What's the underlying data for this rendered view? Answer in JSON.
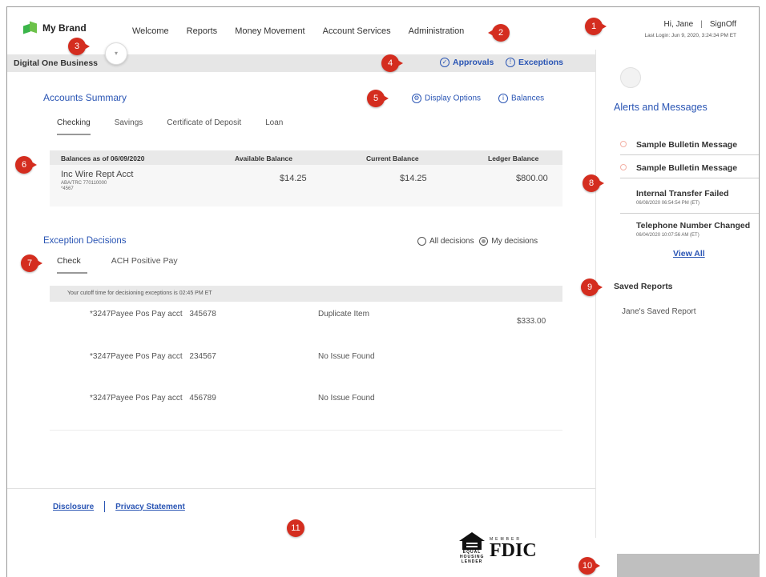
{
  "brand": {
    "name": "My Brand",
    "accent": "#3bb54a"
  },
  "nav": [
    "Welcome",
    "Reports",
    "Money Movement",
    "Account Services",
    "Administration"
  ],
  "user": {
    "greeting": "Hi, Jane",
    "separator": "|",
    "signoff": "SignOff",
    "last_login": "Last Login: Jun 9, 2020, 3:24:34 PM ET"
  },
  "business": {
    "title": "Digital One Business",
    "approvals": "Approvals",
    "exceptions": "Exceptions"
  },
  "accounts": {
    "title": "Accounts Summary",
    "display_options": "Display Options",
    "balances": "Balances",
    "tabs": [
      "Checking",
      "Savings",
      "Certificate of Deposit",
      "Loan"
    ],
    "headers": [
      "Balances as of 06/09/2020",
      "Available Balance",
      "Current Balance",
      "Ledger Balance"
    ],
    "row": {
      "name": "Inc Wire Rept Acct",
      "aba": "ABA/TRC   770110000",
      "num": "*4567",
      "available": "$14.25",
      "current": "$14.25",
      "ledger": "$800.00"
    }
  },
  "exceptions": {
    "title": "Exception Decisions",
    "all_decisions": "All decisions",
    "my_decisions": "My decisions",
    "tabs": [
      "Check",
      "ACH Positive Pay"
    ],
    "cutoff": "Your cutoff time for decisioning exceptions is 02:45 PM ET",
    "rows": [
      {
        "acct": "*3247Payee Pos Pay acct",
        "num": "345678",
        "status": "Duplicate Item",
        "amount": "$333.00"
      },
      {
        "acct": "*3247Payee Pos Pay acct",
        "num": "234567",
        "status": "No Issue Found",
        "amount": ""
      },
      {
        "acct": "*3247Payee Pos Pay acct",
        "num": "456789",
        "status": "No Issue Found",
        "amount": ""
      }
    ]
  },
  "footer": {
    "disclosure": "Disclosure",
    "privacy": "Privacy Statement",
    "fdic": "FDIC",
    "member": "MEMBER",
    "equal_housing": "EQUAL HOUSING LENDER"
  },
  "sidebar": {
    "alerts_title": "Alerts and Messages",
    "alerts": [
      {
        "title": "Sample Bulletin Message",
        "time": ""
      },
      {
        "title": "Sample Bulletin Message",
        "time": ""
      },
      {
        "title": "Internal Transfer Failed",
        "time": "06/08/2020 06:54:54 PM (ET)"
      },
      {
        "title": "Telephone Number Changed",
        "time": "06/04/2020 10:07:56 AM (ET)"
      }
    ],
    "view_all": "View All",
    "saved_reports_title": "Saved Reports",
    "saved_report": "Jane's Saved Report"
  },
  "callouts": [
    "1",
    "2",
    "3",
    "4",
    "5",
    "6",
    "7",
    "8",
    "9",
    "10",
    "11"
  ],
  "icons": {
    "nav_toggle": "chevron-icon",
    "approvals": "approval-icon",
    "exceptions": "exclamation-icon",
    "display_options": "gear-icon",
    "balances": "info-icon"
  },
  "colors": {
    "callout": "#d42d1f",
    "link": "#2a55b4",
    "bar": "#e6e6e6"
  }
}
